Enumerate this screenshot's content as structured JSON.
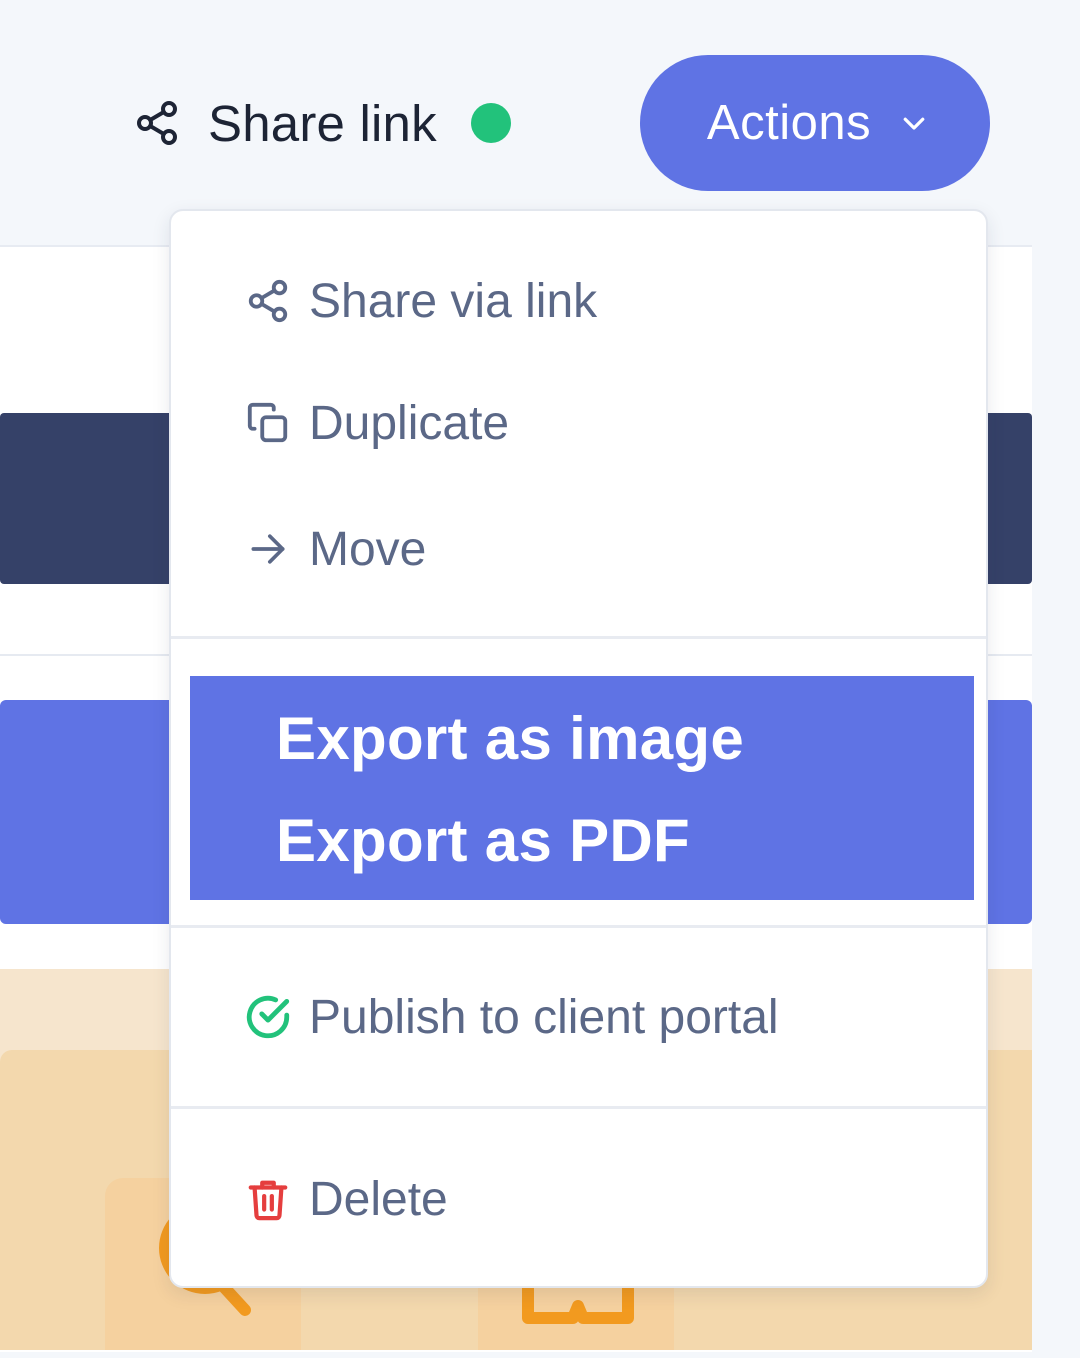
{
  "header": {
    "share_link_label": "Share link",
    "share_status": "active",
    "actions_label": "Actions"
  },
  "menu": {
    "items": [
      {
        "label": "Share via link",
        "icon": "share-icon"
      },
      {
        "label": "Duplicate",
        "icon": "copy-icon"
      },
      {
        "label": "Move",
        "icon": "arrow-right-icon"
      }
    ],
    "export": {
      "image_label": "Export as image",
      "pdf_label": "Export as PDF"
    },
    "publish": {
      "label": "Publish to client portal",
      "icon": "check-circle-icon"
    },
    "delete": {
      "label": "Delete",
      "icon": "trash-icon"
    }
  },
  "colors": {
    "accent": "#5f73e4",
    "status_green": "#22c27b",
    "menu_text": "#5b6887",
    "delete_red": "#e53e3e",
    "dark_band": "#354168"
  }
}
